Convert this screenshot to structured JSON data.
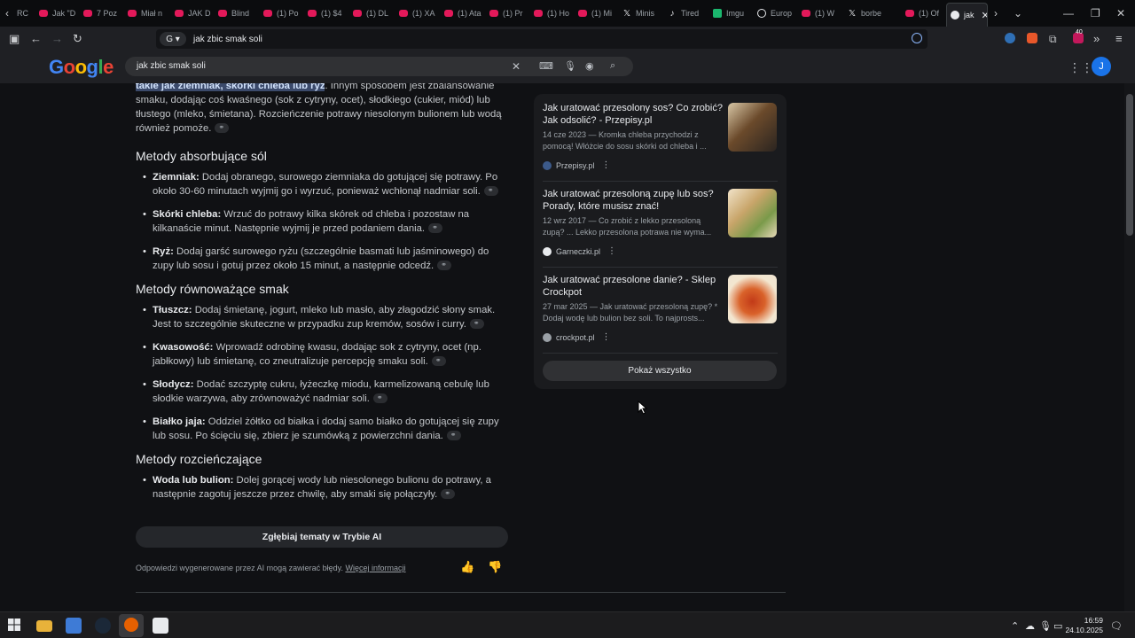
{
  "browser": {
    "tabs": [
      {
        "label": "RC",
        "icon": "chevron-left-icon"
      },
      {
        "label": "Jak \"D",
        "icon": "youtube-icon"
      },
      {
        "label": "7 Poz",
        "icon": "youtube-icon"
      },
      {
        "label": "Miał n",
        "icon": "youtube-icon"
      },
      {
        "label": "JAK D",
        "icon": "youtube-icon"
      },
      {
        "label": "Blind",
        "icon": "youtube-icon"
      },
      {
        "label": "(1) Po",
        "icon": "youtube-icon"
      },
      {
        "label": "(1) $4",
        "icon": "youtube-icon"
      },
      {
        "label": "(1) DL",
        "icon": "youtube-icon"
      },
      {
        "label": "(1) XA",
        "icon": "youtube-icon"
      },
      {
        "label": "(1) Ata",
        "icon": "youtube-icon"
      },
      {
        "label": "(1) Pr",
        "icon": "youtube-icon"
      },
      {
        "label": "(1) Ho",
        "icon": "youtube-icon"
      },
      {
        "label": "(1) Mi",
        "icon": "youtube-icon"
      },
      {
        "label": "Minis",
        "icon": "x-icon"
      },
      {
        "label": "Tired",
        "icon": "tiktok-icon"
      },
      {
        "label": "Imgu",
        "icon": "imgur-icon"
      },
      {
        "label": "Europ",
        "icon": "europe-icon"
      },
      {
        "label": "(1) W",
        "icon": "youtube-icon"
      },
      {
        "label": "borbe",
        "icon": "x-icon"
      },
      {
        "label": "(1) Of",
        "icon": "youtube-icon"
      },
      {
        "label": "jak",
        "icon": "google-icon",
        "active": true
      }
    ],
    "url": "jak zbic smak soli",
    "ext_badge": "40"
  },
  "google": {
    "logo": "Google",
    "query": "jak zbic smak soli",
    "avatar_letter": "J"
  },
  "ai_overview": {
    "intro_highlight": "takie jak ziemniak, skórki chleba lub ryż",
    "intro_rest": ". Innym sposobem jest zbalansowanie smaku, dodając coś kwaśnego (sok z cytryny, ocet), słodkiego (cukier, miód) lub tłustego (mleko, śmietana). Rozcieńczenie potrawy niesolonym bulionem lub wodą również pomoże.",
    "sections": [
      {
        "heading": "Metody absorbujące sól",
        "items": [
          {
            "term": "Ziemniak:",
            "text": " Dodaj obranego, surowego ziemniaka do gotującej się potrawy. Po około 30-60 minutach wyjmij go i wyrzuć, ponieważ wchłonął nadmiar soli."
          },
          {
            "term": "Skórki chleba:",
            "text": " Wrzuć do potrawy kilka skórek od chleba i pozostaw na kilkanaście minut. Następnie wyjmij je przed podaniem dania."
          },
          {
            "term": "Ryż:",
            "text": " Dodaj garść surowego ryżu (szczególnie basmati lub jaśminowego) do zupy lub sosu i gotuj przez około 15 minut, a następnie odcedź."
          }
        ]
      },
      {
        "heading": "Metody równoważące smak",
        "items": [
          {
            "term": "Tłuszcz:",
            "text": " Dodaj śmietanę, jogurt, mleko lub masło, aby złagodzić słony smak. Jest to szczególnie skuteczne w przypadku zup kremów, sosów i curry."
          },
          {
            "term": "Kwasowość:",
            "text": " Wprowadź odrobinę kwasu, dodając sok z cytryny, ocet (np. jabłkowy) lub śmietanę, co zneutralizuje percepcję smaku soli."
          },
          {
            "term": "Słodycz:",
            "text": " Dodać szczyptę cukru, łyżeczkę miodu, karmelizowaną cebulę lub słodkie warzywa, aby zrównoważyć nadmiar soli."
          },
          {
            "term": "Białko jaja:",
            "text": " Oddziel żółtko od białka i dodaj samo białko do gotującej się zupy lub sosu. Po ścięciu się, zbierz je szumówką z powierzchni dania."
          }
        ]
      },
      {
        "heading": "Metody rozcieńczające",
        "items": [
          {
            "term": "Woda lub bulion:",
            "text": " Dolej gorącej wody lub niesolonego bulionu do potrawy, a następnie zagotuj jeszcze przez chwilę, aby smaki się połączyły."
          }
        ]
      }
    ],
    "dive_button": "Zgłębiaj tematy w Trybie AI",
    "disclaimer": "Odpowiedzi wygenerowane przez AI mogą zawierać błędy.",
    "more_info": "Więcej informacji"
  },
  "sources": {
    "items": [
      {
        "title": "Jak uratować przesolony sos? Co zrobić? Jak odsolić? - Przepisy.pl",
        "snippet": "14 cze 2023 — Kromka chleba przychodzi z pomocą! Włóżcie do sosu skórki od chleba i ...",
        "site": "Przepisy.pl",
        "color": "#3c5a8a"
      },
      {
        "title": "Jak uratować przesoloną zupę lub sos? Porady, które musisz znać!",
        "snippet": "12 wrz 2017 — Co zrobić z lekko przesoloną zupą? ... Lekko przesolona potrawa nie wyma...",
        "site": "Garneczki.pl",
        "color": "#e8eaed"
      },
      {
        "title": "Jak uratować przesolone danie? - Sklep Crockpot",
        "snippet": "27 mar 2025 — Jak uratować przesoloną zupę? * Dodaj wodę lub bulion bez soli. To najprosts...",
        "site": "crockpot.pl",
        "color": "#9aa0a6"
      }
    ],
    "show_all": "Pokaż wszystko"
  },
  "taskbar": {
    "time": "16:59",
    "date": "24.10.2025"
  }
}
